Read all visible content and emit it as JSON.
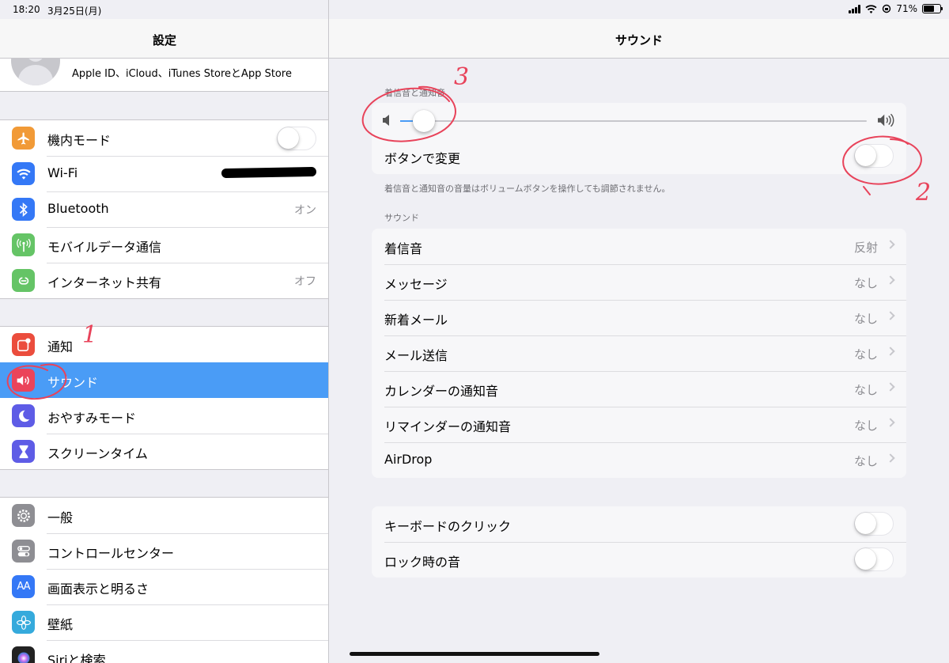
{
  "status_bar": {
    "time": "18:20",
    "date": "3月25日(月)",
    "battery": "71%",
    "battery_level": 0.71
  },
  "sidebar": {
    "title": "設定",
    "apple_id_text": "Apple ID、iCloud、iTunes StoreとApp Store",
    "group1": [
      {
        "label": "機内モード",
        "icon": "airplane-icon",
        "color": "#f19a37",
        "toggle": false
      },
      {
        "label": "Wi-Fi",
        "icon": "wifi-icon",
        "color": "#3478f6",
        "value": ""
      },
      {
        "label": "Bluetooth",
        "icon": "bluetooth-icon",
        "color": "#3478f6",
        "value": "オン"
      },
      {
        "label": "モバイルデータ通信",
        "icon": "cellular-icon",
        "color": "#65c466",
        "value": ""
      },
      {
        "label": "インターネット共有",
        "icon": "hotspot-icon",
        "color": "#65c466",
        "value": "オフ"
      }
    ],
    "group2": [
      {
        "label": "通知",
        "icon": "notification-icon",
        "color": "#eb4d3d"
      },
      {
        "label": "サウンド",
        "icon": "speaker-icon",
        "color": "#eb445a",
        "selected": true
      },
      {
        "label": "おやすみモード",
        "icon": "moon-icon",
        "color": "#5e5ce6"
      },
      {
        "label": "スクリーンタイム",
        "icon": "hourglass-icon",
        "color": "#5e5ce6"
      }
    ],
    "group3": [
      {
        "label": "一般",
        "icon": "gear-icon",
        "color": "#8e8e93"
      },
      {
        "label": "コントロールセンター",
        "icon": "switches-icon",
        "color": "#8e8e93"
      },
      {
        "label": "画面表示と明るさ",
        "icon": "text-size-icon",
        "color": "#3478f6",
        "icon_text": "AA"
      },
      {
        "label": "壁紙",
        "icon": "flower-icon",
        "color": "#35aadc"
      },
      {
        "label": "Siriと検索",
        "icon": "siri-icon",
        "color": "#222222"
      }
    ]
  },
  "main": {
    "title": "サウンド",
    "ringer_section_label": "着信音と通知音",
    "volume_level": 0.05,
    "change_with_buttons_label": "ボタンで変更",
    "change_with_buttons_on": false,
    "ringer_note": "着信音と通知音の音量はボリュームボタンを操作しても調節されません。",
    "sounds_section_label": "サウンド",
    "sounds": [
      {
        "label": "着信音",
        "value": "反射"
      },
      {
        "label": "メッセージ",
        "value": "なし"
      },
      {
        "label": "新着メール",
        "value": "なし"
      },
      {
        "label": "メール送信",
        "value": "なし"
      },
      {
        "label": "カレンダーの通知音",
        "value": "なし"
      },
      {
        "label": "リマインダーの通知音",
        "value": "なし"
      },
      {
        "label": "AirDrop",
        "value": "なし"
      }
    ],
    "keyboard_click_label": "キーボードのクリック",
    "lock_sound_label": "ロック時の音"
  },
  "annotations": {
    "one": "1",
    "two": "2",
    "three": "3",
    "color": "#e8435a"
  }
}
